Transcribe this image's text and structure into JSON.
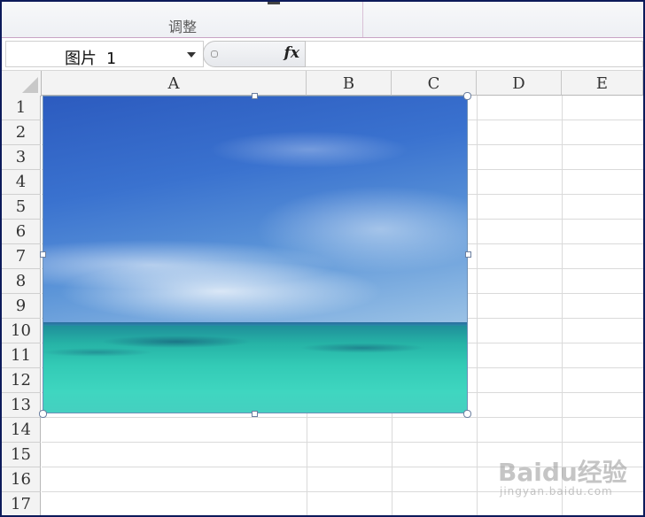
{
  "ribbon": {
    "group_label": "调整"
  },
  "formula_bar": {
    "name_box": "图片 1",
    "fx_label": "fx",
    "formula": ""
  },
  "columns": [
    "A",
    "B",
    "C",
    "D",
    "E"
  ],
  "rows": [
    "1",
    "2",
    "3",
    "4",
    "5",
    "6",
    "7",
    "8",
    "9",
    "10",
    "11",
    "12",
    "13",
    "14",
    "15",
    "16",
    "17"
  ],
  "picture": {
    "name": "图片 1",
    "description": "sky and turquoise sea photo"
  },
  "watermark": {
    "brand": "Baidu经验",
    "url": "jingyan.baidu.com"
  }
}
